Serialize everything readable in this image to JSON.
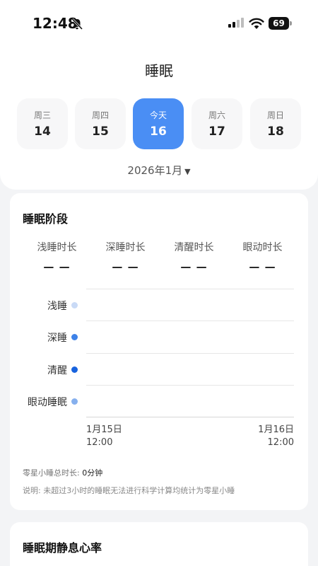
{
  "status_bar": {
    "time": "12:48",
    "battery": "69"
  },
  "header": {
    "title": "睡眠"
  },
  "days": [
    {
      "weekday": "周三",
      "day": "14"
    },
    {
      "weekday": "周四",
      "day": "15"
    },
    {
      "weekday": "今天",
      "day": "16"
    },
    {
      "weekday": "周六",
      "day": "17"
    },
    {
      "weekday": "周日",
      "day": "18"
    }
  ],
  "month": {
    "label": "2026年1月",
    "caret": "▼"
  },
  "sleep_stage_card": {
    "title": "睡眠阶段",
    "metrics": [
      {
        "label": "浅睡时长",
        "value": "— —"
      },
      {
        "label": "深睡时长",
        "value": "— —"
      },
      {
        "label": "清醒时长",
        "value": "— —"
      },
      {
        "label": "眼动时长",
        "value": "— —"
      }
    ],
    "legend": [
      {
        "label": "浅睡",
        "color": "#c9daf6"
      },
      {
        "label": "深睡",
        "color": "#3d82e8"
      },
      {
        "label": "清醒",
        "color": "#1863de"
      },
      {
        "label": "眼动睡眠",
        "color": "#86b0ee"
      }
    ],
    "x_axis": {
      "start_date": "1月15日",
      "start_time": "12:00",
      "end_date": "1月16日",
      "end_time": "12:00"
    },
    "nap_label": "零星小睡总时长: ",
    "nap_value": "0分钟",
    "note": "说明: 未超过3小时的睡眠无法进行科学计算均统计为零星小睡"
  },
  "resting_hr_card": {
    "title": "睡眠期静息心率"
  },
  "colors": {
    "accent": "#4a8ef4",
    "background": "#f3f4f6"
  }
}
